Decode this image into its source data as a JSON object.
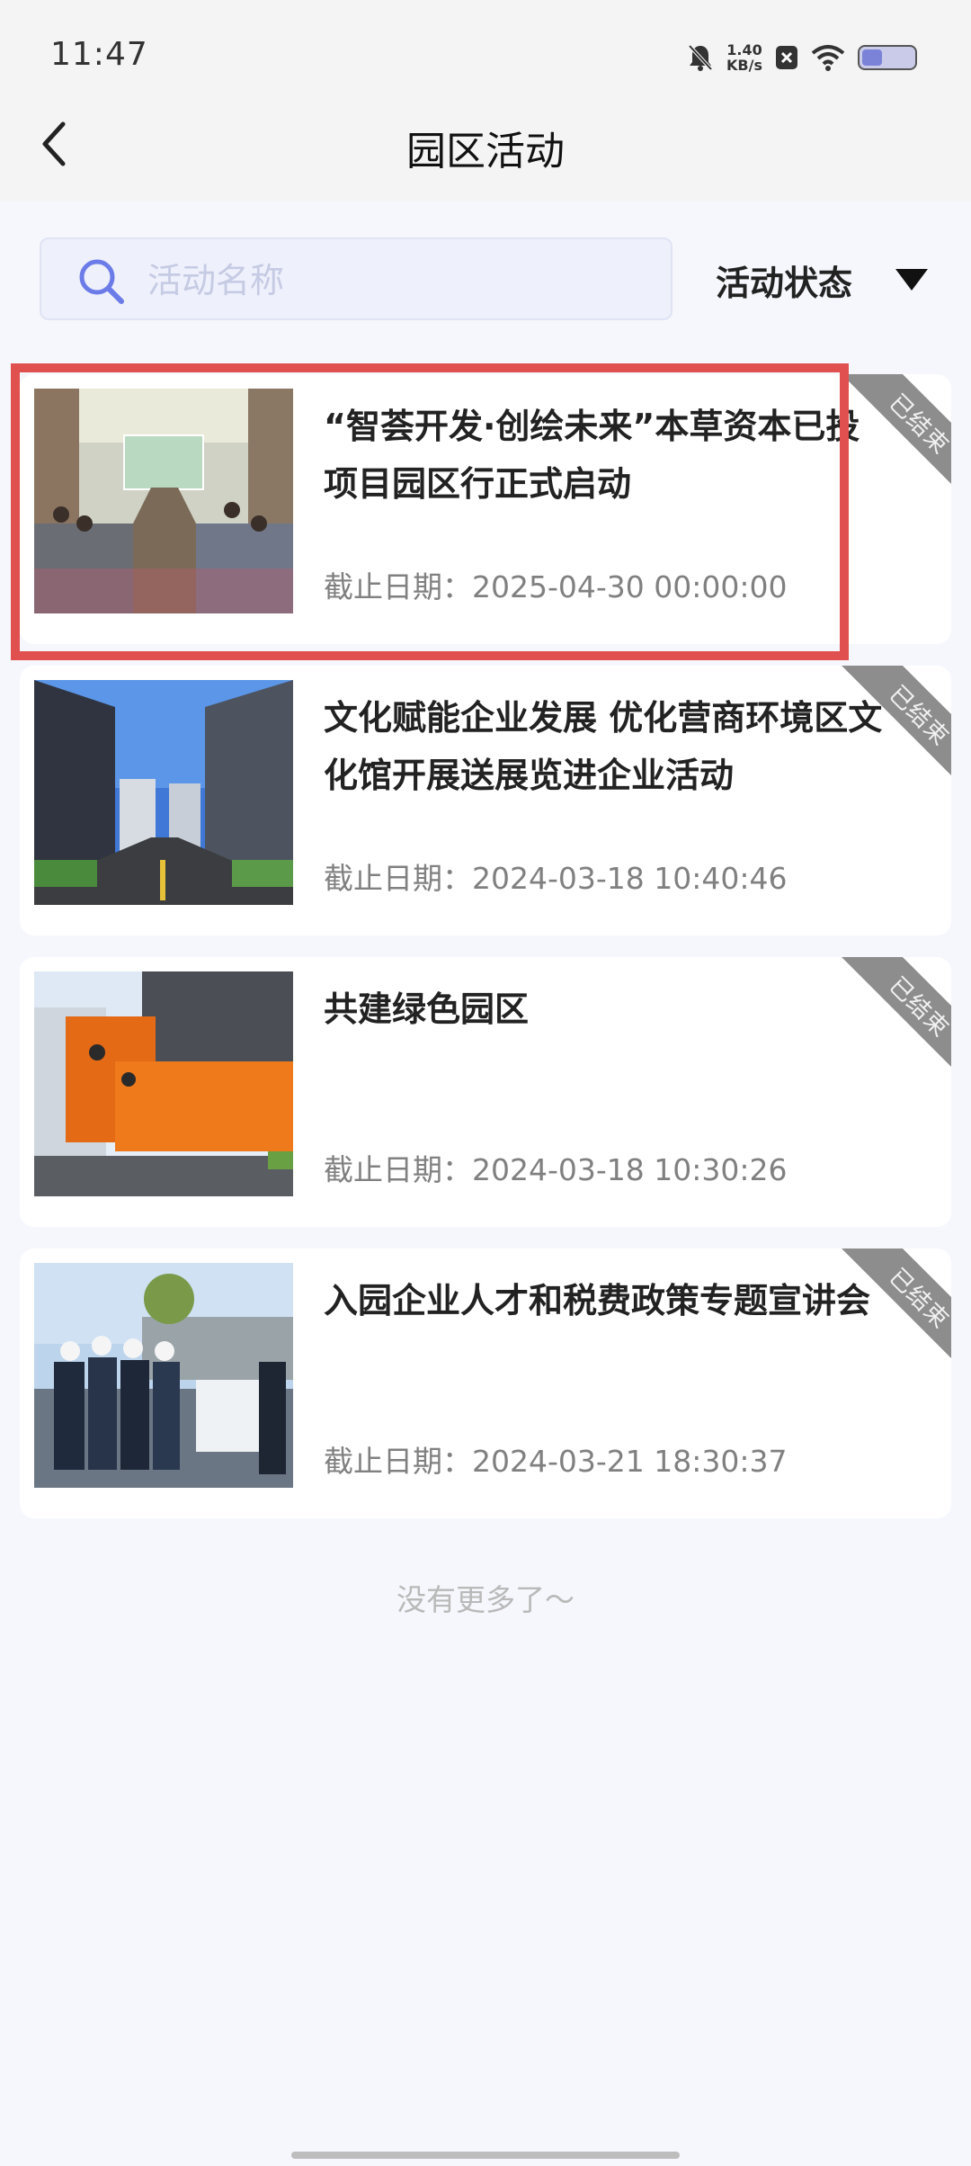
{
  "status_bar": {
    "time": "11:47",
    "speed_value": "1.40",
    "speed_unit": "KB/s"
  },
  "header": {
    "title": "园区活动"
  },
  "search": {
    "placeholder": "活动名称",
    "value": ""
  },
  "filter": {
    "label": "活动状态"
  },
  "activities": [
    {
      "title": "“智荟开发·创绘未来”本草资本已投项目园区行正式启动",
      "date": "截止日期：2025-04-30 00:00:00",
      "badge": "已结束"
    },
    {
      "title": "文化赋能企业发展 优化营商环境区文化馆开展送展览进企业活动",
      "date": "截止日期：2024-03-18 10:40:46",
      "badge": "已结束"
    },
    {
      "title": "共建绿色园区",
      "date": "截止日期：2024-03-18 10:30:26",
      "badge": "已结束"
    },
    {
      "title": "入园企业人才和税费政策专题宣讲会",
      "date": "截止日期：2024-03-21 18:30:37",
      "badge": "已结束"
    }
  ],
  "footer": {
    "no_more": "没有更多了～"
  },
  "colors": {
    "highlight": "#e0504e",
    "ribbon": "#8d8d8d",
    "search_icon": "#6b7ce8"
  }
}
